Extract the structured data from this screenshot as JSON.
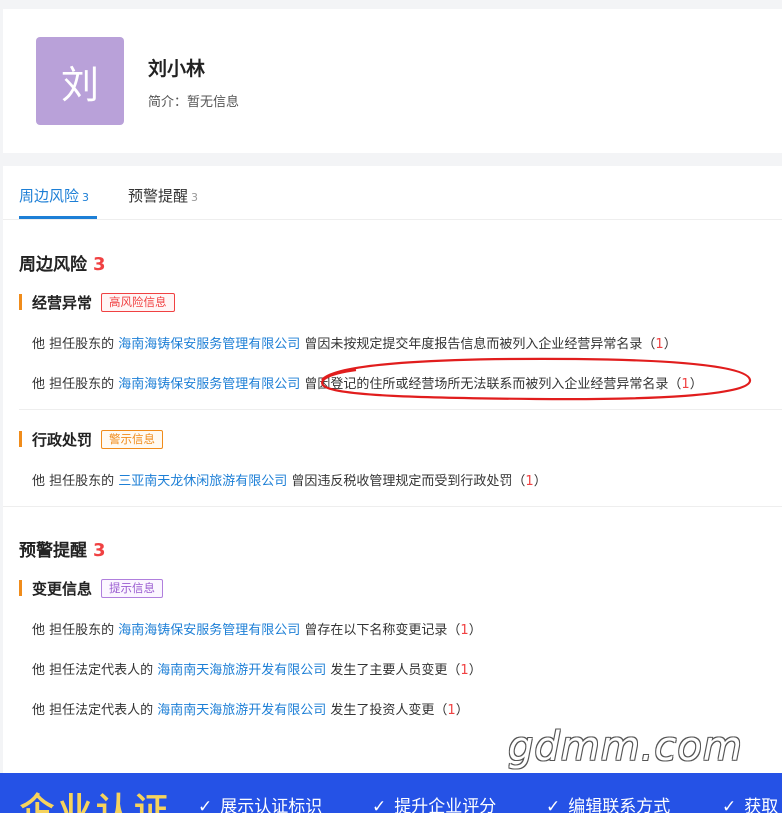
{
  "profile": {
    "avatar_char": "刘",
    "name": "刘小林",
    "intro": "简介：暂无信息"
  },
  "tabs": [
    {
      "label": "周边风险",
      "count": "3"
    },
    {
      "label": "预警提醒",
      "count": "3"
    }
  ],
  "risk_section": {
    "title": "周边风险",
    "count": "3",
    "groups": [
      {
        "title": "经营异常",
        "tag": "高风险信息",
        "rows": [
          {
            "prefix": "他 担任股东的 ",
            "company": "海南海铸保安服务管理有限公司",
            "text": " 曾因未按规定提交年度报告信息而被列入企业经营异常名录（",
            "count": "1",
            "suffix": "）"
          },
          {
            "prefix": "他 担任股东的 ",
            "company": "海南海铸保安服务管理有限公司",
            "text": " 曾因登记的住所或经营场所无法联系而被列入企业经营异常名录（",
            "count": "1",
            "suffix": "）"
          }
        ]
      },
      {
        "title": "行政处罚",
        "tag": "警示信息",
        "rows": [
          {
            "prefix": "他 担任股东的 ",
            "company": "三亚南天龙休闲旅游有限公司",
            "text": " 曾因违反税收管理规定而受到行政处罚（",
            "count": "1",
            "suffix": "）"
          }
        ]
      }
    ]
  },
  "warning_section": {
    "title": "预警提醒",
    "count": "3",
    "groups": [
      {
        "title": "变更信息",
        "tag": "提示信息",
        "rows": [
          {
            "prefix": "他 担任股东的 ",
            "company": "海南海铸保安服务管理有限公司",
            "text": " 曾存在以下名称变更记录（",
            "count": "1",
            "suffix": "）"
          },
          {
            "prefix": "他 担任法定代表人的 ",
            "company": "海南南天海旅游开发有限公司",
            "text": " 发生了主要人员变更（",
            "count": "1",
            "suffix": "）"
          },
          {
            "prefix": "他 担任法定代表人的 ",
            "company": "海南南天海旅游开发有限公司",
            "text": " 发生了投资人变更（",
            "count": "1",
            "suffix": "）"
          }
        ]
      }
    ]
  },
  "watermark": "gdmm.com",
  "banner": {
    "title": "企业认证",
    "items": [
      "展示认证标识",
      "提升企业评分",
      "编辑联系方式",
      "获取"
    ]
  },
  "colors": {
    "accent_blue": "#1d7fd6",
    "risk_red": "#f04142",
    "bar_orange": "#f08c1b",
    "avatar_purple": "#b9a1d9",
    "banner_blue": "#2552e6"
  }
}
